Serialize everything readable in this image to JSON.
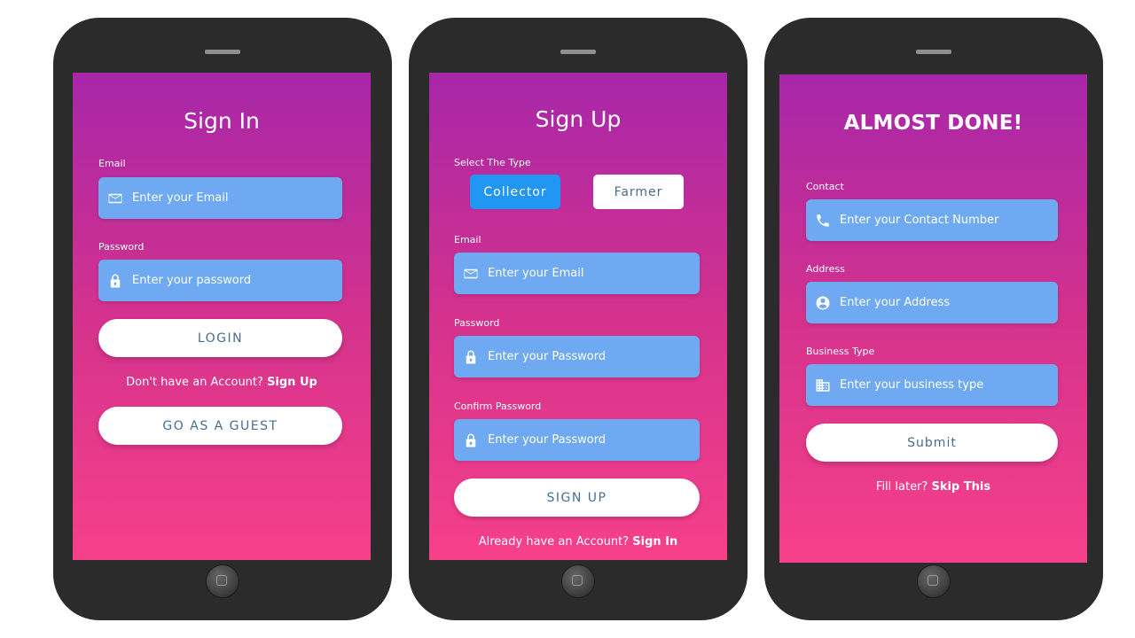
{
  "colors": {
    "gradient_top": "#a726a9",
    "gradient_bottom": "#f7408a",
    "field_bg": "#6ea9f1",
    "button_text": "#4a6d8c",
    "toggle_active": "#2196f3"
  },
  "signin": {
    "title": "Sign In",
    "email_label": "Email",
    "email_placeholder": "Enter your Email",
    "email_icon": "envelope-icon",
    "password_label": "Password",
    "password_placeholder": "Enter your password",
    "password_icon": "lock-icon",
    "login_button": "LOGIN",
    "no_account_text": "Don't have an Account?",
    "signup_link": "Sign Up",
    "guest_button": "GO AS A GUEST"
  },
  "signup": {
    "title": "Sign Up",
    "type_label": "Select The Type",
    "type_collector": "Collector",
    "type_farmer": "Farmer",
    "selected_type": "Collector",
    "email_label": "Email",
    "email_placeholder": "Enter your Email",
    "password_label": "Password",
    "password_placeholder": "Enter your Password",
    "confirm_label": "Confirm Password",
    "confirm_placeholder": "Enter your Password",
    "signup_button": "SIGN UP",
    "have_account_text": "Already have an Account?",
    "signin_link": "Sign In"
  },
  "almost": {
    "title": "ALMOST DONE!",
    "contact_label": "Contact",
    "contact_placeholder": "Enter your Contact Number",
    "contact_icon": "phone-icon",
    "address_label": "Address",
    "address_placeholder": "Enter your Address",
    "address_icon": "user-circle-icon",
    "business_label": "Business Type",
    "business_placeholder": "Enter your business type",
    "business_icon": "building-icon",
    "submit_button": "Submit",
    "fill_later_text": "Fill later?",
    "skip_link": "Skip This"
  }
}
